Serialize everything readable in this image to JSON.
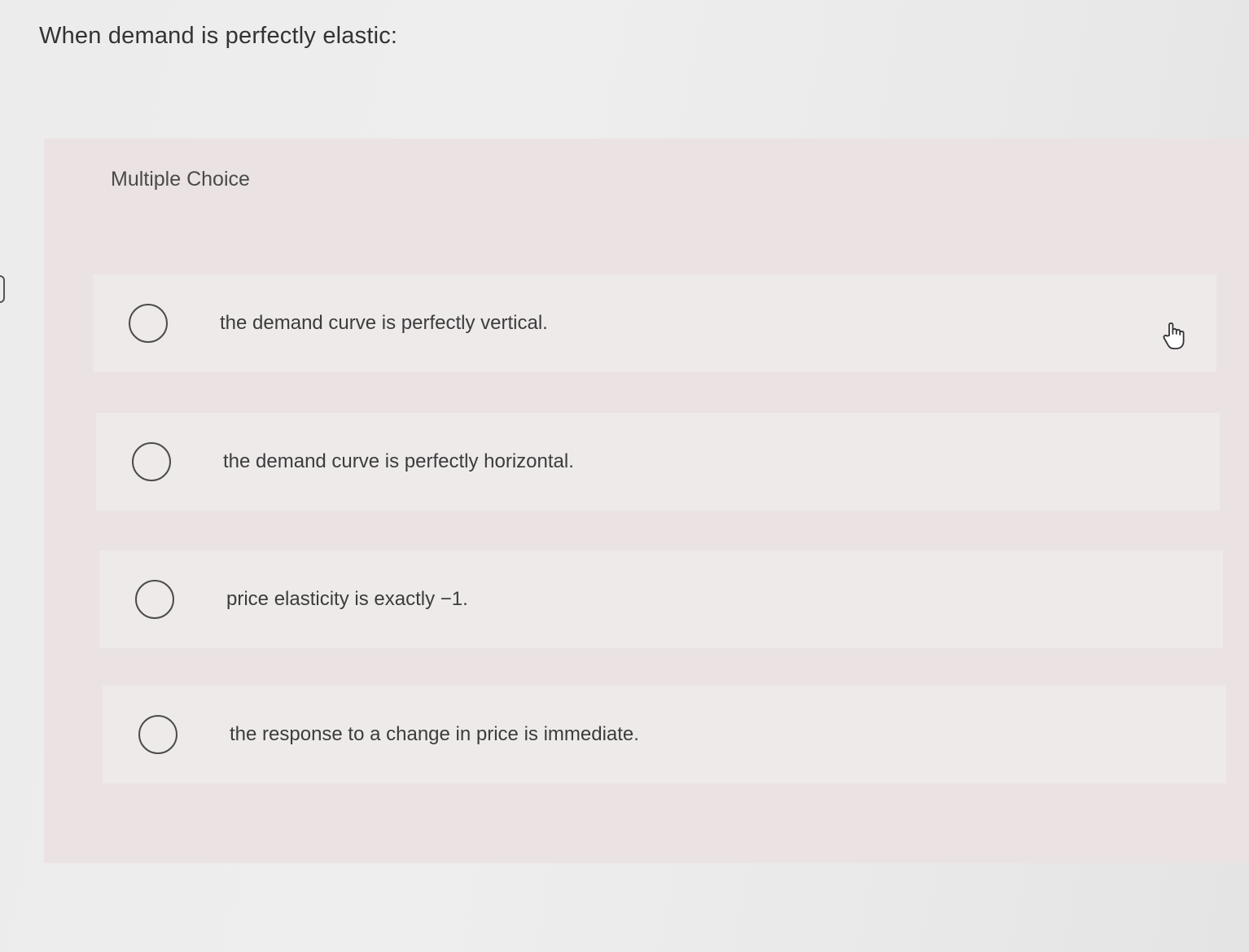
{
  "question": {
    "prompt": "When demand is perfectly elastic:"
  },
  "multiple_choice": {
    "header_label": "Multiple Choice",
    "selected": null,
    "options": [
      {
        "label": "the demand curve is perfectly vertical."
      },
      {
        "label": "the demand curve is perfectly horizontal."
      },
      {
        "label": "price elasticity is exactly −1."
      },
      {
        "label": "the response to a change in price is immediate."
      }
    ]
  },
  "icons": {
    "cursor": "hand-pointer-icon",
    "radio": "radio-unchecked-icon"
  },
  "colors": {
    "page_background": "#ececec",
    "panel_background": "#ebe3e3",
    "text": "#3c3c3c",
    "radio_border": "#4c4c4c"
  }
}
